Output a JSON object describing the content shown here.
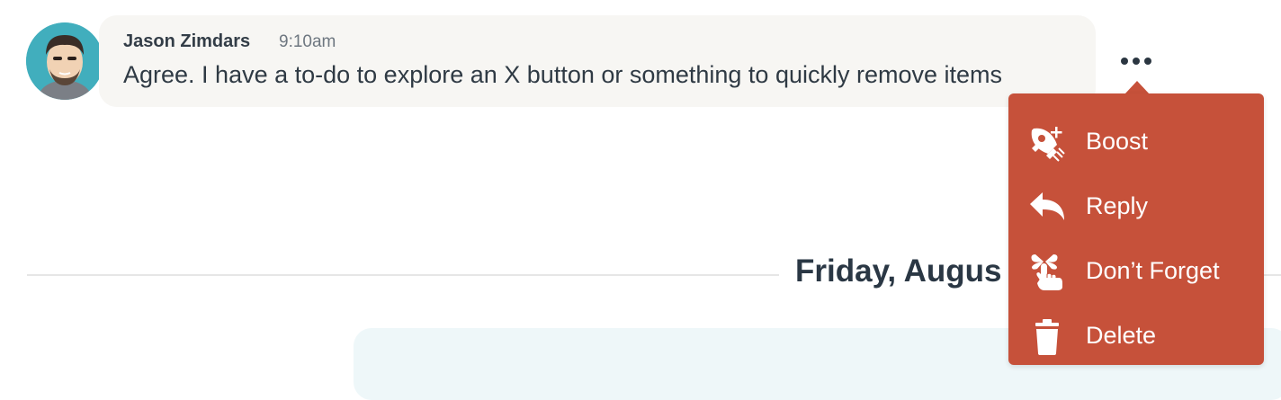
{
  "message": {
    "author": "Jason Zimdars",
    "time": "9:10am",
    "text": "Agree. I have a to-do to explore an X button or something to quickly remove items",
    "avatar_icon": "cartoon-avatar"
  },
  "more_button": {
    "icon": "more-horizontal-icon"
  },
  "date_divider": {
    "label": "Friday, Augus"
  },
  "menu": {
    "background": "#c6513a",
    "items": [
      {
        "label": "Boost",
        "icon": "rocket-boost-icon"
      },
      {
        "label": "Reply",
        "icon": "reply-arrow-icon"
      },
      {
        "label": "Don’t Forget",
        "icon": "finger-ribbon-icon"
      },
      {
        "label": "Delete",
        "icon": "trash-icon"
      }
    ]
  }
}
